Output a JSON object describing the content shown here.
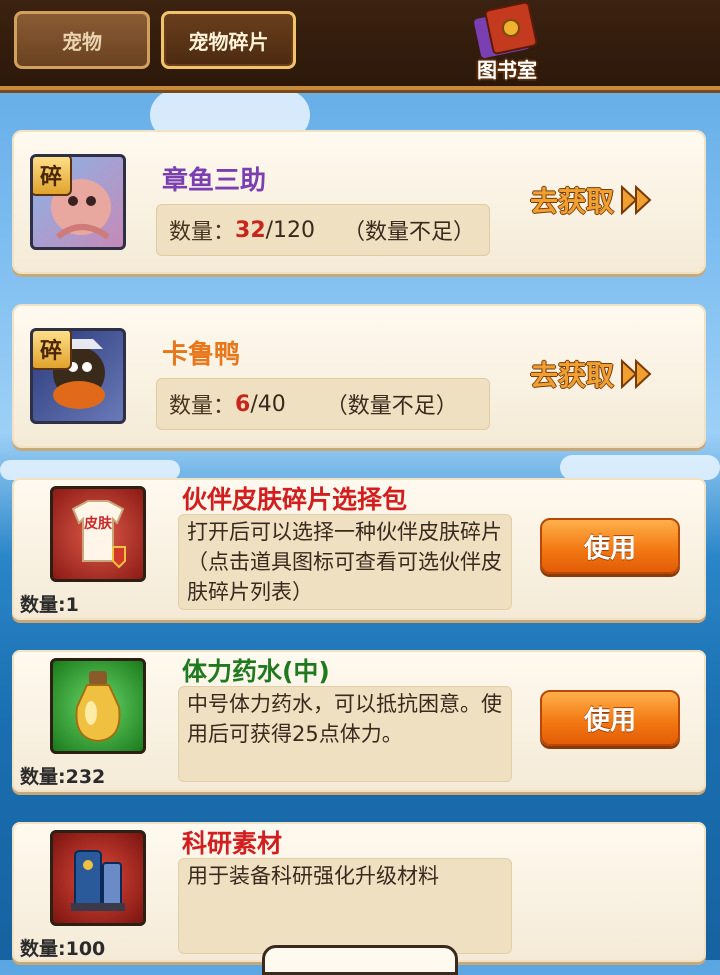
{
  "tabs": [
    {
      "label": "宠物",
      "active": false
    },
    {
      "label": "宠物碎片",
      "active": true
    }
  ],
  "library": {
    "label": "图书室",
    "icon": "book-icon"
  },
  "fragments": [
    {
      "name": "章鱼三助",
      "name_color": "#7a3fb0",
      "badge": "碎",
      "count": "32",
      "total": "/120",
      "quantity_label": "数量：",
      "note": "（数量不足）",
      "action": "去获取",
      "icon": "octopus-portrait-icon"
    },
    {
      "name": "卡鲁鸭",
      "name_color": "#e8761a",
      "badge": "碎",
      "count": "6",
      "total": "/40",
      "quantity_label": "数量：",
      "note": "（数量不足）",
      "action": "去获取",
      "icon": "duck-portrait-icon"
    }
  ],
  "items": [
    {
      "name": "伙伴皮肤碎片选择包",
      "name_color": "#d21e1e",
      "count_label": "数量:1",
      "description": "打开后可以选择一种伙伴皮肤碎片（点击道具图标可查看可选伙伴皮肤碎片列表）",
      "button": "使用",
      "icon": "skin-shirt-icon",
      "icon_text": "皮肤"
    },
    {
      "name": "体力药水(中)",
      "name_color": "#1f7a1f",
      "count_label": "数量:232",
      "description": "中号体力药水，可以抵抗困意。使用后可获得25点体力。",
      "button": "使用",
      "icon": "potion-bottle-icon"
    },
    {
      "name": "科研素材",
      "name_color": "#d21e1e",
      "count_label": "数量:100",
      "description": "用于装备科研强化升级材料",
      "button": "",
      "icon": "research-device-icon"
    }
  ]
}
